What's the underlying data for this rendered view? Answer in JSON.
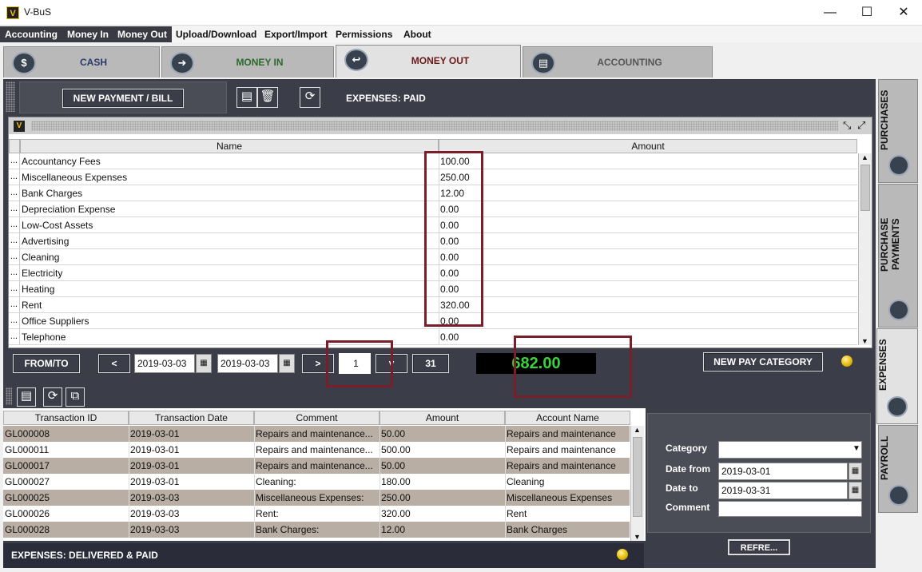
{
  "window": {
    "title": "V-BuS",
    "logo": "V",
    "minimize": "—",
    "maximize": "☐",
    "close": "✕"
  },
  "menu": [
    "Accounting",
    "Money In",
    "Money Out",
    "Upload/Download",
    "Export/Import",
    "Permissions",
    "About"
  ],
  "module_tabs": {
    "cash": "CASH",
    "money_in": "MONEY IN",
    "money_out": "MONEY OUT",
    "accounting": "ACCOUNTING"
  },
  "toolbar": {
    "new_payment": "NEW PAYMENT / BILL",
    "caption": "EXPENSES: PAID"
  },
  "expense_table": {
    "headers": {
      "name": "Name",
      "amount": "Amount"
    },
    "rows": [
      {
        "dots": "...",
        "name": "Accountancy Fees",
        "amount": "100.00"
      },
      {
        "dots": "...",
        "name": "Miscellaneous Expenses",
        "amount": "250.00"
      },
      {
        "dots": "...",
        "name": "Bank Charges",
        "amount": "12.00"
      },
      {
        "dots": "...",
        "name": "Depreciation Expense",
        "amount": "0.00"
      },
      {
        "dots": "...",
        "name": "Low-Cost Assets",
        "amount": "0.00"
      },
      {
        "dots": "...",
        "name": "Advertising",
        "amount": "0.00"
      },
      {
        "dots": "...",
        "name": "Cleaning",
        "amount": "0.00"
      },
      {
        "dots": "...",
        "name": "Electricity",
        "amount": "0.00"
      },
      {
        "dots": "...",
        "name": "Heating",
        "amount": "0.00"
      },
      {
        "dots": "...",
        "name": "Rent",
        "amount": "320.00"
      },
      {
        "dots": "...",
        "name": "Office Suppliers",
        "amount": "0.00"
      },
      {
        "dots": "...",
        "name": "Telephone",
        "amount": "0.00"
      }
    ]
  },
  "nav": {
    "from_to": "FROM/TO",
    "prev": "<",
    "date_from": "2019-03-03",
    "date_to": "2019-03-03",
    "next": ">",
    "day_value": "1",
    "day_down": "˅",
    "days_31": "31",
    "total": "682.00",
    "new_pay_category": "NEW PAY CATEGORY"
  },
  "transactions": {
    "headers": {
      "id": "Transaction ID",
      "date": "Transaction Date",
      "comment": "Comment",
      "amount": "Amount",
      "account": "Account Name"
    },
    "rows": [
      {
        "id": "GL000008",
        "date": "2019-03-01",
        "comment": "Repairs and maintenance...",
        "amount": "50.00",
        "account": "Repairs and maintenance"
      },
      {
        "id": "GL000011",
        "date": "2019-03-01",
        "comment": "Repairs and maintenance...",
        "amount": "500.00",
        "account": "Repairs and maintenance"
      },
      {
        "id": "GL000017",
        "date": "2019-03-01",
        "comment": "Repairs and maintenance...",
        "amount": "50.00",
        "account": "Repairs and maintenance"
      },
      {
        "id": "GL000027",
        "date": "2019-03-01",
        "comment": "Cleaning:",
        "amount": "180.00",
        "account": "Cleaning"
      },
      {
        "id": "GL000025",
        "date": "2019-03-03",
        "comment": "Miscellaneous Expenses:",
        "amount": "250.00",
        "account": "Miscellaneous Expenses"
      },
      {
        "id": "GL000026",
        "date": "2019-03-03",
        "comment": "Rent:",
        "amount": "320.00",
        "account": "Rent"
      },
      {
        "id": "GL000028",
        "date": "2019-03-03",
        "comment": "Bank Charges:",
        "amount": "12.00",
        "account": "Bank Charges"
      }
    ]
  },
  "filter": {
    "category_label": "Category",
    "category_value": "",
    "date_from_label": "Date from",
    "date_from": "2019-03-01",
    "date_to_label": "Date to",
    "date_to": "2019-03-31",
    "comment_label": "Comment",
    "comment_value": "",
    "refresh": "REFRE..."
  },
  "status_caption": "EXPENSES: DELIVERED & PAID",
  "side_tabs": {
    "purchases": "PURCHASES",
    "purchase_payments": "PURCHASE PAYMENTS",
    "expenses": "EXPENSES",
    "payroll": "PAYROLL"
  },
  "colors": {
    "panel": "#3b3d48",
    "highlight": "#7a1e2a",
    "total_text": "#3bd23b",
    "odd_row": "#b9aea3"
  }
}
